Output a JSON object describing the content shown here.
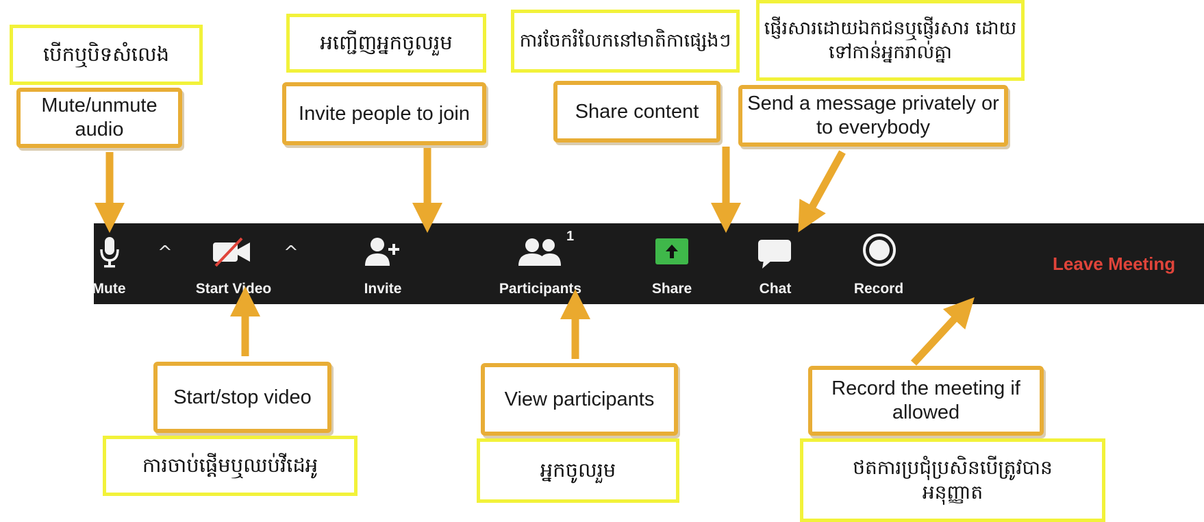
{
  "toolbar": {
    "mute_label": "Mute",
    "video_label": "Start Video",
    "invite_label": "Invite",
    "participants_label": "Participants",
    "participants_count": "1",
    "share_label": "Share",
    "chat_label": "Chat",
    "record_label": "Record",
    "leave_label": "Leave Meeting",
    "caret_glyph": "^",
    "colors": {
      "background": "#1b1b1b",
      "share_green": "#3fb84a",
      "leave_red": "#e0443a",
      "video_slash": "#e0443a"
    }
  },
  "callouts": {
    "mute": "Mute/unmute audio",
    "invite": "Invite people to join",
    "share": "Share content",
    "chat": "Send a message privately or to everybody",
    "video": "Start/stop video",
    "participants": "View participants",
    "record": "Record the meeting if allowed"
  },
  "khmer_labels": {
    "mute": "បើកឬបិទសំលេង",
    "invite": "អញ្ជើញអ្នកចូលរួម",
    "share": "ការចែករំលែកនៅមាតិកាផ្សេងៗ",
    "chat": "ផ្ញើរសារដោយឯកជនឬផ្ញើរសារ ដោយទៅកាន់អ្នករាល់គ្នា",
    "video": "ការចាប់ផ្តើមឬឈប់វីដេអូ",
    "participants": "អ្នកចូលរួម",
    "record": "ថតការប្រជុំប្រសិនបើត្រូវបានអនុញ្ញាត"
  },
  "icons": [
    "microphone-icon",
    "caret-icon",
    "video-off-icon",
    "add-user-icon",
    "participants-icon",
    "share-arrow-icon",
    "chat-bubble-icon",
    "record-icon"
  ],
  "colors": {
    "callout_border": "#e8ad36",
    "khmer_border": "#f2f23a",
    "arrow": "#eaa92e"
  }
}
